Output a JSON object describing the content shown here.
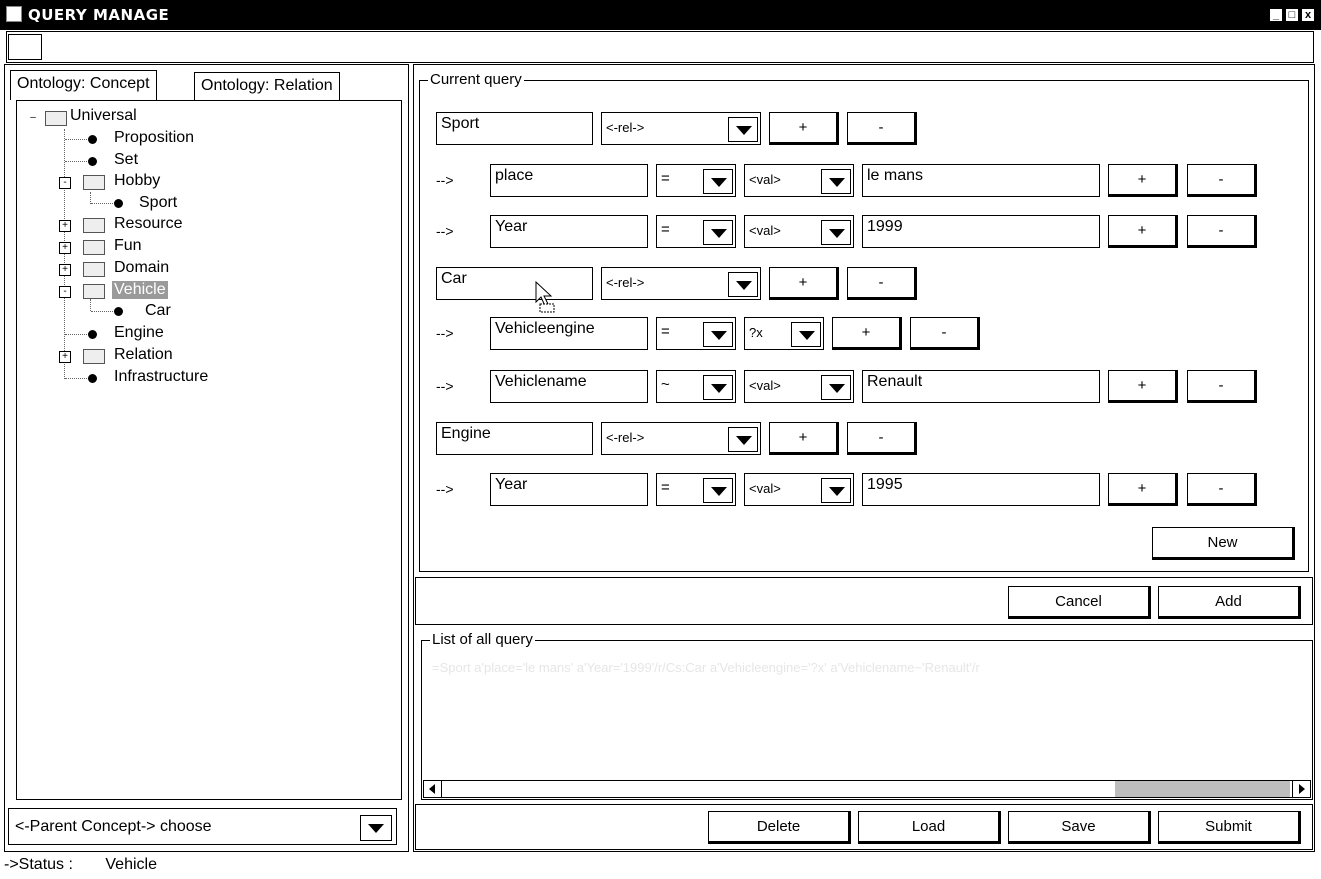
{
  "window": {
    "title": "QUERY MANAGE",
    "minimize": "_",
    "maximize": "□",
    "close": "x"
  },
  "tabs": [
    {
      "label": "Ontology: Concept"
    },
    {
      "label": "Ontology: Relation"
    }
  ],
  "tree": {
    "universal": "Universal",
    "proposition": "Proposition",
    "set": "Set",
    "hobby": "Hobby",
    "sport": "Sport",
    "resource": "Resource",
    "fun": "Fun",
    "domain": "Domain",
    "vehicle": "Vehicle",
    "car": "Car",
    "engine": "Engine",
    "relation": "Relation",
    "infrastructure": "Infrastructure"
  },
  "parent_combo": "<-Parent Concept-> choose",
  "current_query": {
    "legend": "Current query",
    "rows": [
      {
        "kind": "concept",
        "concept": "Sport",
        "rel": "<-rel->"
      },
      {
        "kind": "attr",
        "arrow": "-->",
        "attr": "place",
        "op": "=",
        "valtype": "<val>",
        "value": "le mans"
      },
      {
        "kind": "attr",
        "arrow": "-->",
        "attr": "Year",
        "op": "=",
        "valtype": "<val>",
        "value": "1999"
      },
      {
        "kind": "concept",
        "concept": "Car",
        "rel": "<-rel->"
      },
      {
        "kind": "attr",
        "arrow": "-->",
        "attr": "Vehicleengine",
        "op": "=",
        "valtype": "?x",
        "value": ""
      },
      {
        "kind": "attr",
        "arrow": "-->",
        "attr": "Vehiclename",
        "op": "~",
        "valtype": "<val>",
        "value": "Renault"
      },
      {
        "kind": "concept",
        "concept": "Engine",
        "rel": "<-rel->"
      },
      {
        "kind": "attr",
        "arrow": "-->",
        "attr": "Year",
        "op": "=",
        "valtype": "<val>",
        "value": "1995"
      }
    ],
    "plus": "+",
    "minus": "-",
    "new_label": "New"
  },
  "actions": {
    "cancel": "Cancel",
    "add": "Add"
  },
  "list": {
    "legend": "List of all query",
    "text": "=Sport a'place='le mans' a'Year='1999'/r/Cs:Car a'Vehicleengine='?x' a'Vehiclename~'Renault'/r"
  },
  "bottom_buttons": {
    "delete": "Delete",
    "load": "Load",
    "save": "Save",
    "submit": "Submit"
  },
  "status": {
    "label": "->Status :",
    "value": "Vehicle"
  }
}
